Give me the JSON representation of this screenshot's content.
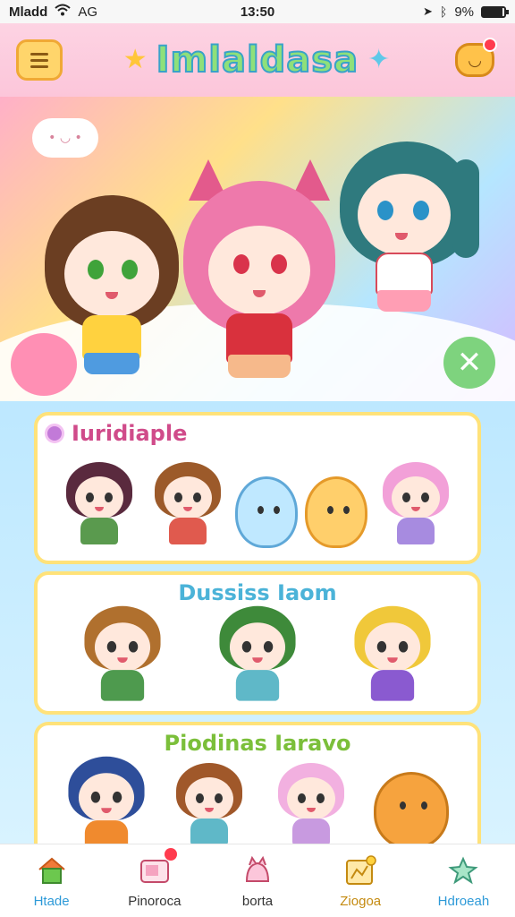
{
  "status_bar": {
    "carrier": "Mladd",
    "network": "AG",
    "time": "13:50",
    "battery": "9%",
    "battery_level": 0.9
  },
  "header": {
    "title": "Imlaldasa",
    "menu_icon": "menu-icon",
    "chat_icon": "chat-bubble-icon",
    "notification": true
  },
  "sections": [
    {
      "title": "Iuridiaple",
      "title_color": "#d04b8a"
    },
    {
      "title": "Dussiss Iaom",
      "title_color": "#4bb3d8"
    },
    {
      "title": "Piodinas Iaravo",
      "title_color": "#7bbf3a"
    }
  ],
  "tabs": [
    {
      "label": "Htade",
      "icon": "home-icon",
      "color": "#2e9ad8",
      "active": true
    },
    {
      "label": "Pinoroca",
      "icon": "tv-icon",
      "color": "#333333",
      "badge": true
    },
    {
      "label": "borta",
      "icon": "character-icon",
      "color": "#333333"
    },
    {
      "label": "Ziogoa",
      "icon": "map-icon",
      "color": "#c48a10"
    },
    {
      "label": "Hdroeah",
      "icon": "sparkle-friend-icon",
      "color": "#2e9ad8"
    }
  ],
  "colors": {
    "accent_pink": "#fcc6da",
    "accent_yellow": "#ffe27a",
    "accent_blue": "#bde8ff"
  }
}
